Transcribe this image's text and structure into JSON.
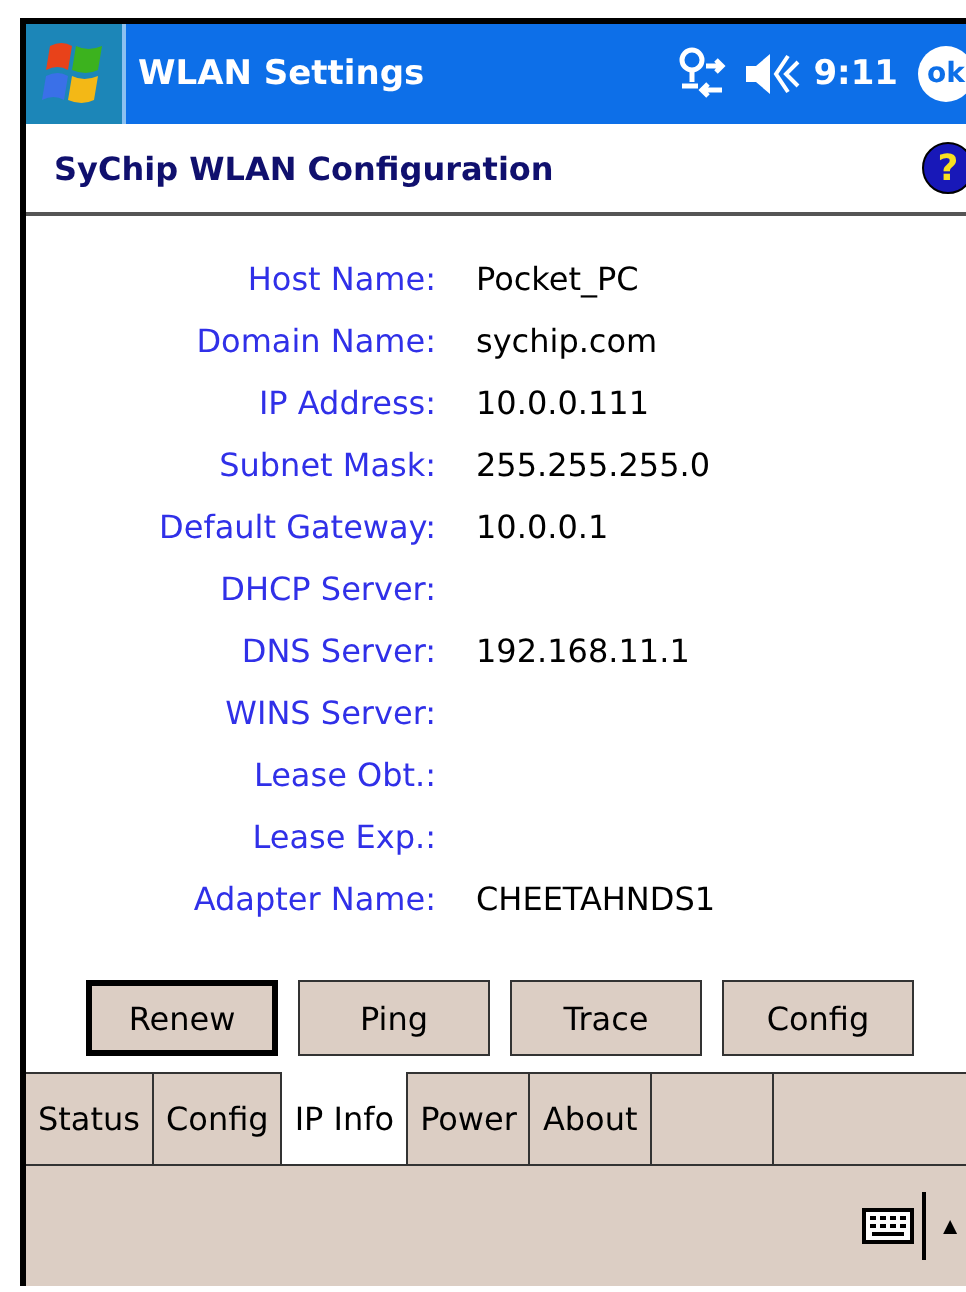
{
  "title_bar": {
    "title": "WLAN Settings",
    "time": "9:11",
    "ok": "ok"
  },
  "header": {
    "title": "SyChip WLAN Configuration",
    "help": "?"
  },
  "fields": [
    {
      "label": "Host Name:",
      "value": "Pocket_PC"
    },
    {
      "label": "Domain Name:",
      "value": "sychip.com"
    },
    {
      "label": "IP Address:",
      "value": "10.0.0.111"
    },
    {
      "label": "Subnet Mask:",
      "value": "255.255.255.0"
    },
    {
      "label": "Default Gateway:",
      "value": "10.0.0.1"
    },
    {
      "label": "DHCP Server:"
    },
    {
      "label": "DNS Server:",
      "value": "192.168.11.1"
    },
    {
      "label": "WINS Server:"
    },
    {
      "label": "Lease Obt.:"
    },
    {
      "label": "Lease Exp.:"
    },
    {
      "label": "Adapter Name:",
      "value": "CHEETAHNDS1"
    }
  ],
  "buttons": [
    {
      "label": "Renew",
      "default": true
    },
    {
      "label": "Ping",
      "default": false
    },
    {
      "label": "Trace",
      "default": false
    },
    {
      "label": "Config",
      "default": false
    }
  ],
  "tabs": [
    {
      "label": "Status",
      "selected": false
    },
    {
      "label": "Config",
      "selected": false
    },
    {
      "label": "IP Info",
      "selected": true
    },
    {
      "label": "Power",
      "selected": false
    },
    {
      "label": "About",
      "selected": false
    }
  ],
  "menu_bar": {
    "arrow": "▲"
  }
}
